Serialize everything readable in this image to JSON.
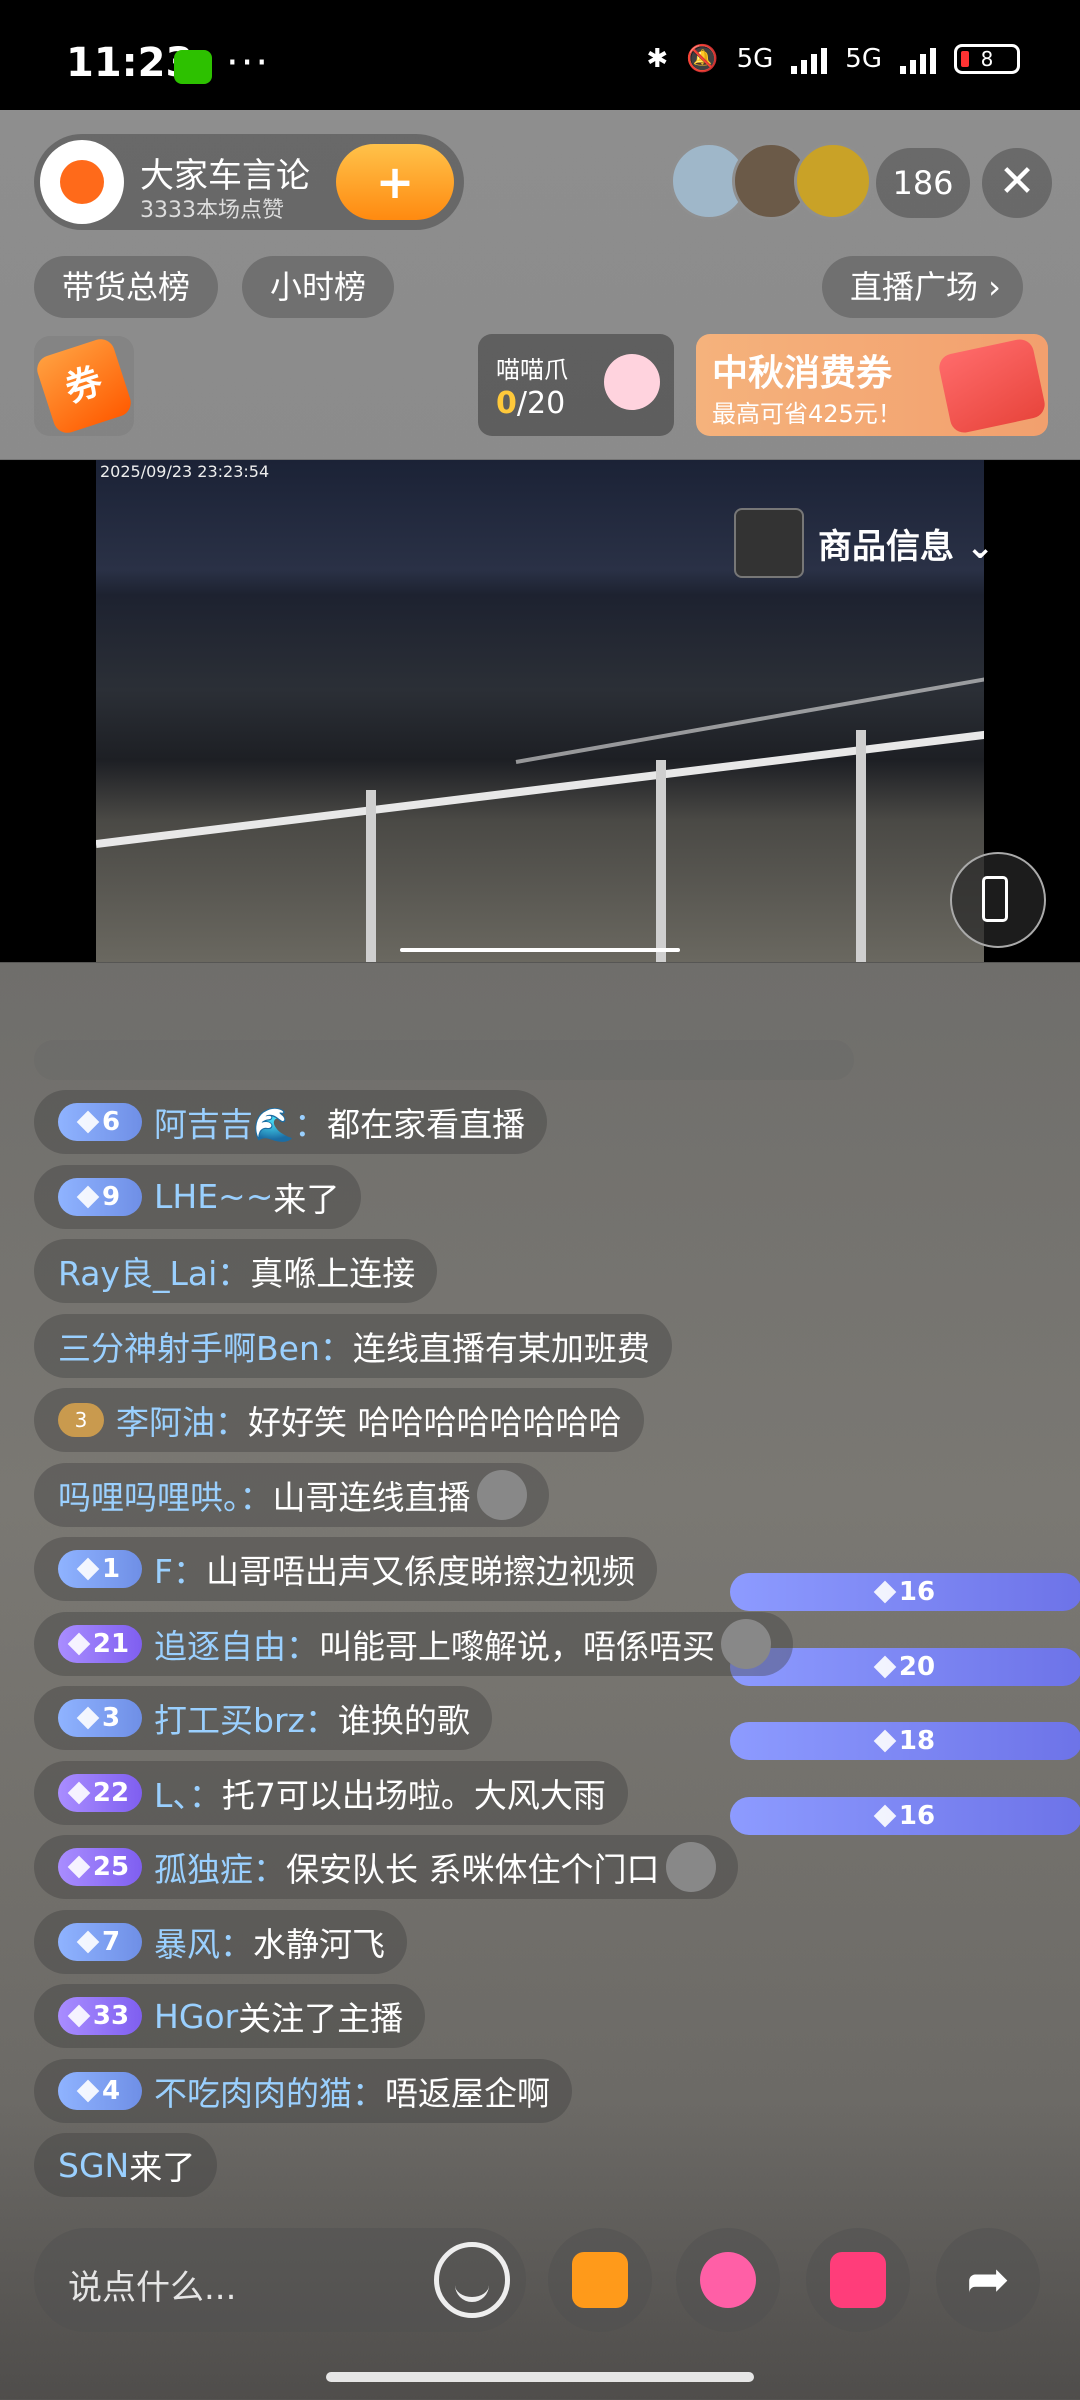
{
  "status_bar": {
    "time": "11:23",
    "dots": "···",
    "net1": "5G",
    "net2": "5G",
    "battery": "8"
  },
  "host": {
    "name": "大家车言论",
    "likes": "3333本场点赞",
    "follow_label": "+"
  },
  "viewer_count": "186",
  "close_label": "✕",
  "tabs": {
    "rank_sales": "带货总榜",
    "rank_hour": "小时榜",
    "plaza": "直播广场 ›"
  },
  "coupon": {
    "label": "券"
  },
  "claw": {
    "title": "喵喵爪",
    "progress_current": "0",
    "progress_total": "/20"
  },
  "promo": {
    "title": "中秋消费券",
    "subtitle": "最高可省425元！"
  },
  "video": {
    "timestamp": "2025/09/23  23:23:54"
  },
  "product_info": {
    "label": "商品信息 ⌄"
  },
  "chat": [
    {
      "level": "6",
      "tier": "low",
      "user": "阿吉吉🌊：",
      "text": "都在家看直播"
    },
    {
      "level": "9",
      "tier": "low",
      "user": "LHE~~",
      "text": " 来了"
    },
    {
      "level": "16",
      "tier": "mid",
      "user": "Ray良_Lai：",
      "text": "真喺上连接"
    },
    {
      "level": "20",
      "tier": "mid",
      "user": "三分神射手啊Ben：",
      "text": "连线直播有某加班费"
    },
    {
      "level": "18",
      "tier": "mid",
      "badge": "3",
      "user": "李阿油：",
      "text": "好好笑 哈哈哈哈哈哈哈哈"
    },
    {
      "level": "16",
      "tier": "mid",
      "user": "吗哩吗哩哄。：",
      "text": "山哥连线直播",
      "emoji": true
    },
    {
      "level": "1",
      "tier": "low",
      "user": "F：",
      "text": "山哥唔出声又係度睇擦边视频"
    },
    {
      "level": "21",
      "tier": "high",
      "user": "追逐自由：",
      "text": "叫能哥上嚟解说，唔係唔买",
      "emoji": true
    },
    {
      "level": "3",
      "tier": "low",
      "user": "打工买brz：",
      "text": "谁换的歌"
    },
    {
      "level": "22",
      "tier": "high",
      "user": "L、：",
      "text": "托7可以出场啦。大风大雨"
    },
    {
      "level": "25",
      "tier": "high",
      "user": "孤独症：",
      "text": "保安队长 系咪体住个门口",
      "emoji": true
    },
    {
      "level": "7",
      "tier": "low",
      "user": "暴风：",
      "text": "水静河飞"
    },
    {
      "level": "33",
      "tier": "high",
      "user": "HGor",
      "text": " 关注了主播"
    },
    {
      "level": "4",
      "tier": "low",
      "user": "不吃肉肉的猫：",
      "text": "唔返屋企啊"
    },
    {
      "user": "SGN",
      "text": " 来了"
    }
  ],
  "input": {
    "placeholder": "说点什么..."
  },
  "colors": {
    "accent": "#ff8a10",
    "username": "#9ad0ff",
    "claw_count": "#ffc93a"
  }
}
